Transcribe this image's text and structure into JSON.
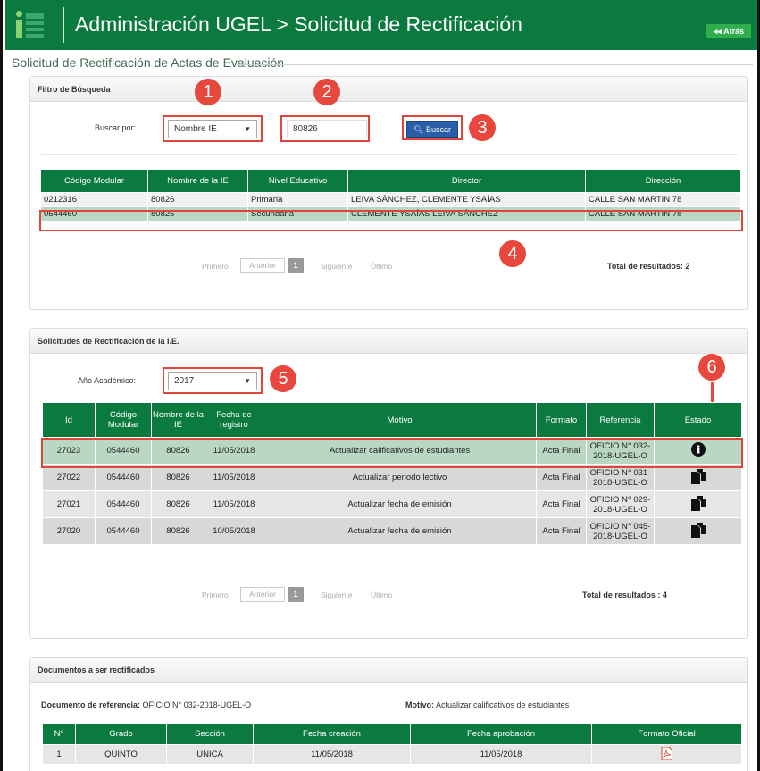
{
  "header": {
    "title": "Administración UGEL > Solicitud de Rectificación",
    "back": "◂◂ Atrás"
  },
  "page_title": "Solicitud de Rectificación de Actas de Evaluación",
  "filter": {
    "heading": "Filtro de Búsqueda",
    "buscar_label": "Buscar por:",
    "buscar_por": "Nombre IE",
    "search_value": "80826",
    "search_button": "Buscar"
  },
  "ie_table": {
    "headers": [
      "Código Modular",
      "Nombre de la IE",
      "Nivel Educativo",
      "Director",
      "Dirección"
    ],
    "rows": [
      [
        "0212316",
        "80826",
        "Primaria",
        "LEIVA SÁNCHEZ, CLEMENTE YSAÍAS",
        "CALLE SAN MARTIN 78"
      ],
      [
        "0544460",
        "80826",
        "Secundaria",
        "CLEMENTE YSAÍAS LEIVA SÁNCHEZ",
        "CALLE SAN MARTIN 78"
      ]
    ]
  },
  "pagination1": {
    "primero": "Primero",
    "anterior": "Anterior",
    "page": "1",
    "siguiente": "Siguiente",
    "ultimo": "Último",
    "total": "Total de resultados: 2"
  },
  "solicitudes": {
    "heading": "Solicitudes de Rectificación de la I.E.",
    "anio_label": "Año Académico:",
    "anio": "2017",
    "headers": [
      "Id",
      "Código Modular",
      "Nombre de la IE",
      "Fecha de registro",
      "Motivo",
      "Formato",
      "Referencia",
      "Estado"
    ],
    "rows": [
      [
        "27023",
        "0544460",
        "80826",
        "11/05/2018",
        "Actualizar calificativos de estudiantes",
        "Acta Final",
        "OFICIO N° 032-2018-UGEL-O"
      ],
      [
        "27022",
        "0544460",
        "80826",
        "11/05/2018",
        "Actualizar periodo lectivo",
        "Acta Final",
        "OFICIO N° 031-2018-UGEL-O"
      ],
      [
        "27021",
        "0544460",
        "80826",
        "11/05/2018",
        "Actualizar fecha de emisión",
        "Acta Final",
        "OFICIO N° 029-2018-UGEL-O"
      ],
      [
        "27020",
        "0544460",
        "80826",
        "10/05/2018",
        "Actualizar fecha de emisión",
        "Acta Final",
        "OFICIO N° 045-2018-UGEL-O"
      ]
    ]
  },
  "pagination2": {
    "primero": "Primero",
    "anterior": "Anterior",
    "page": "1",
    "siguiente": "Siguiente",
    "ultimo": "Último",
    "total": "Total de resultados : 4"
  },
  "documentos": {
    "heading": "Documentos a ser rectificados",
    "ref_label": "Documento de referencia:",
    "ref_value": "OFICIO N° 032-2018-UGEL-O",
    "motivo_label": "Motivo:",
    "motivo_value": "Actualizar calificativos de estudiantes",
    "headers": [
      "N°",
      "Grado",
      "Sección",
      "Fecha creación",
      "Fecha aprobación",
      "Formato Oficial"
    ],
    "rows": [
      [
        "1",
        "QUINTO",
        "UNICA",
        "11/05/2018",
        "11/05/2018"
      ]
    ]
  },
  "badges": [
    "1",
    "2",
    "3",
    "4",
    "5",
    "6"
  ],
  "colors": {
    "header_green": "#0b7a3f",
    "highlight": "#e0453a",
    "selected_row": "#b9d7c3"
  }
}
